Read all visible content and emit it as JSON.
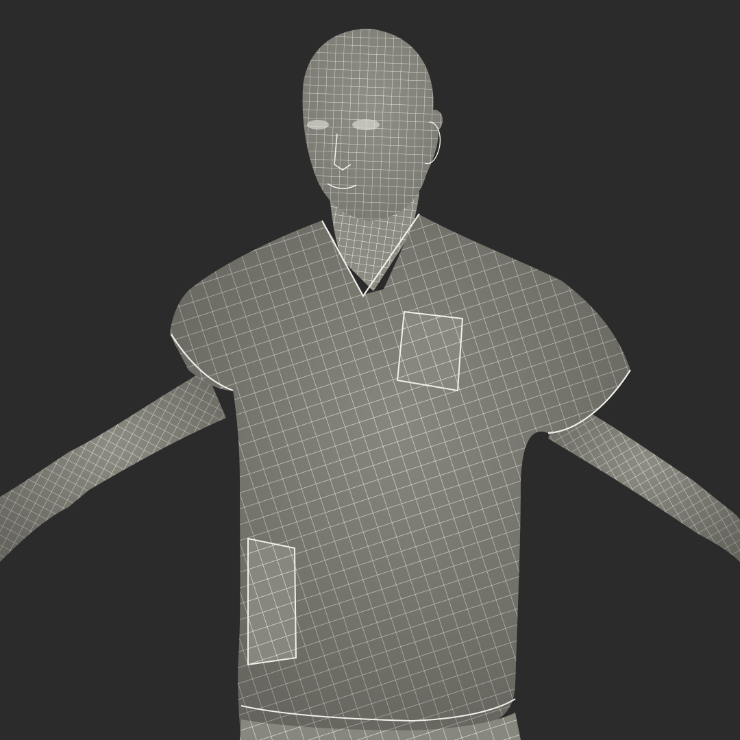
{
  "scene": {
    "subject": "3d-figure-in-scrubs-wireframe",
    "background_color": "#2b2b2b",
    "surface_color": "#8a8a80",
    "wire_color": "#ecebe2",
    "render_mode": "wireframe-on-shaded"
  },
  "icons": {
    "figure": "human-model-icon"
  }
}
